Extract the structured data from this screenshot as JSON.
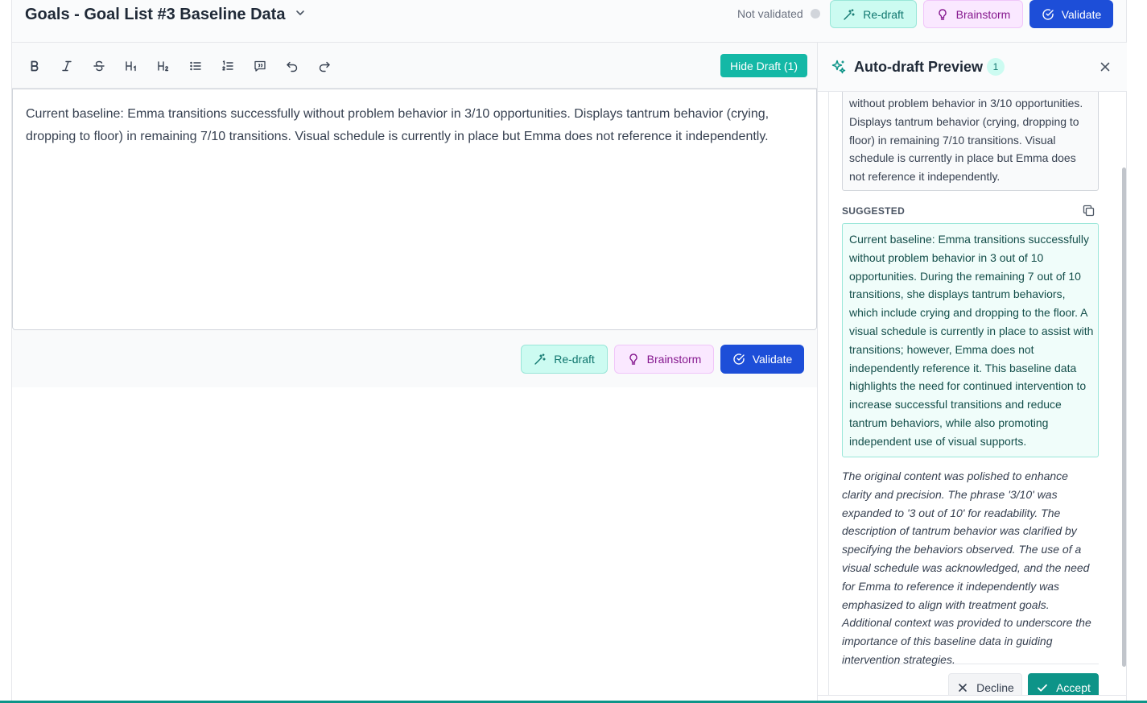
{
  "header": {
    "title": "Goals - Goal List #3 Baseline Data",
    "status": "Not validated",
    "redraft_label": "Re-draft",
    "brainstorm_label": "Brainstorm",
    "validate_label": "Validate"
  },
  "toolbar": {
    "tools": [
      "bold-icon",
      "italic-icon",
      "strikethrough-icon",
      "heading-1-icon",
      "heading-2-icon",
      "bullet-list-icon",
      "numbered-list-icon",
      "quote-icon",
      "undo-icon",
      "redo-icon"
    ],
    "hide_draft_label": "Hide Draft (1)"
  },
  "editor": {
    "content": "Current baseline: Emma transitions successfully without problem behavior in 3/10 opportunities. Displays tantrum behavior (crying, dropping to floor) in remaining 7/10 transitions. Visual schedule is currently in place but Emma does not reference it independently."
  },
  "actions": {
    "redraft_label": "Re-draft",
    "brainstorm_label": "Brainstorm",
    "validate_label": "Validate"
  },
  "panel": {
    "title": "Auto-draft Preview",
    "count": "1",
    "original_text": "without problem behavior in 3/10 opportunities. Displays tantrum behavior (crying, dropping to floor) in remaining 7/10 transitions. Visual schedule is currently in place but Emma does not reference it independently.",
    "suggested_label": "SUGGESTED",
    "suggested_text": "Current baseline: Emma transitions successfully without problem behavior in 3 out of 10 opportunities. During the remaining 7 out of 10 transitions, she displays tantrum behaviors, which include crying and dropping to the floor. A visual schedule is currently in place to assist with transitions; however, Emma does not independently reference it. This baseline data highlights the need for continued intervention to increase successful transitions and reduce tantrum behaviors, while also promoting independent use of visual supports.",
    "explanation": "The original content was polished to enhance clarity and precision. The phrase '3/10' was expanded to '3 out of 10' for readability. The description of tantrum behavior was clarified by specifying the behaviors observed. The use of a visual schedule was acknowledged, and the need for Emma to reference it independently was emphasized to align with treatment goals. Additional context was provided to underscore the importance of this baseline data in guiding intervention strategies.",
    "decline_label": "Decline",
    "accept_label": "Accept"
  },
  "colors": {
    "accent_teal": "#14b8a6",
    "validate_blue": "#1d4ed8",
    "brainstorm_purple": "#86198f"
  }
}
